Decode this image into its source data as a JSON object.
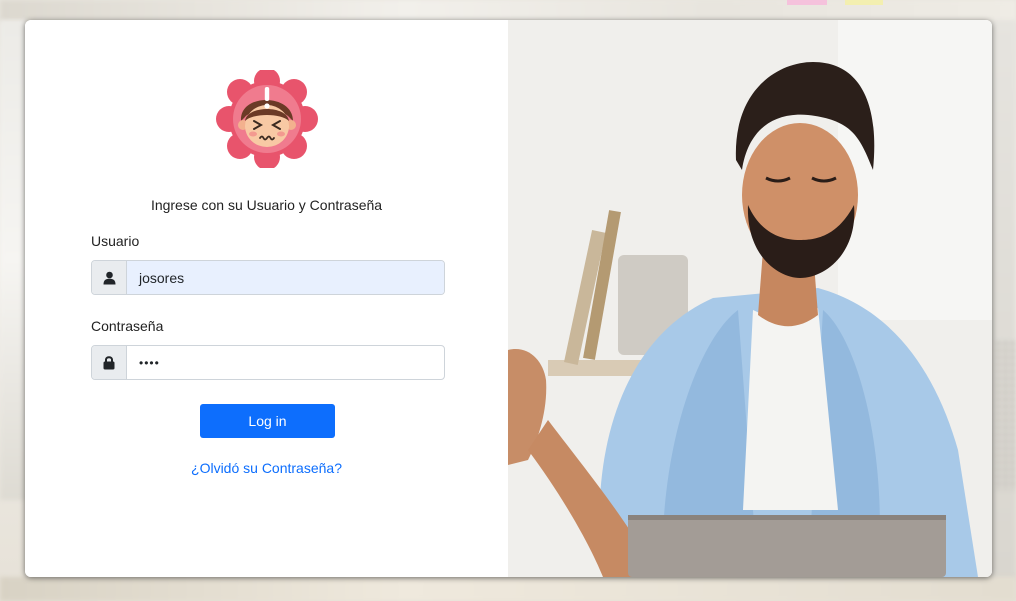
{
  "login": {
    "subtitle": "Ingrese con su Usuario y Contraseña",
    "username_label": "Usuario",
    "username_value": "josores",
    "password_label": "Contraseña",
    "password_value": "••••",
    "submit_label": "Log in",
    "forgot_link": "¿Olvidó su Contraseña?"
  },
  "icons": {
    "logo": "stressed-face-badge-icon",
    "username": "user-icon",
    "password": "lock-icon"
  },
  "colors": {
    "primary": "#0d6efd",
    "autofill": "#e8f0fe",
    "logo_badge": "#e8546c"
  }
}
